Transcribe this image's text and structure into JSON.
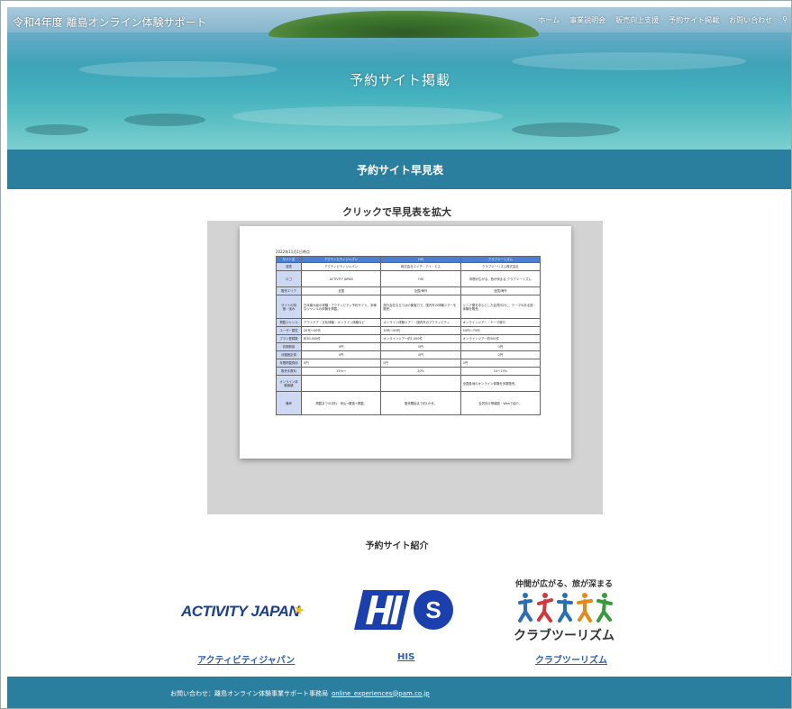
{
  "header": {
    "site_title": "令和4年度 離島オンライン体験サポート",
    "nav": [
      "ホーム",
      "事業説明会",
      "販売向上支援",
      "予約サイト掲載",
      "お問い合わせ"
    ],
    "hero_title": "予約サイト掲載"
  },
  "section_bar": {
    "title": "予約サイト早見表"
  },
  "preview": {
    "caption": "クリックで早見表を拡大",
    "doc_date": "2022年11月1日時点",
    "columns": [
      "サイト名",
      "アクティビティジャパン",
      "HIS",
      "クラブツーリズム"
    ],
    "rows": [
      {
        "head": "運営",
        "cells": [
          "アクティビティジャパン",
          "株式会社エイチ・アイ・エス",
          "クラブツーリズム株式会社"
        ]
      },
      {
        "head": "ロゴ",
        "cells": [
          "ACTIVITY JAPAN",
          "HIS",
          "仲間が広がる、旅が深まる クラブツーリズム"
        ]
      },
      {
        "head": "販売エリア",
        "cells": [
          "全国",
          "全国/海外",
          "全国/海外"
        ]
      },
      {
        "head": "サイトの特徴・強み",
        "cells": [
          "日本最大級の体験・アクティビティ予約サイト。多様なジャンルの体験を掲載。",
          "旅行会社ならではの集客力で、国内外の体験ツアーを販売。",
          "シニア層を中心とした会員向けに、テーマのある旅・体験を販売。"
        ]
      },
      {
        "head": "掲載ジャンル",
        "cells": [
          "アウトドア・文化体験・オンライン体験など",
          "オンライン体験ツアー・国内外のアクティビティ",
          "オンラインツアー・テーマ旅行"
        ]
      },
      {
        "head": "ユーザー属性",
        "cells": [
          "20代〜40代",
          "30代〜60代",
          "50代〜70代"
        ]
      },
      {
        "head": "プラン登録数",
        "cells": [
          "約30,000件",
          "オンラインツアー約1,000件",
          "オンラインツアー約500件"
        ]
      },
      {
        "head": "初期費用",
        "cells": [
          "0円",
          "0円",
          "0円"
        ]
      },
      {
        "head": "月額固定費",
        "cells": [
          "0円",
          "0円",
          "0円"
        ]
      },
      {
        "head": "年間掲載費用",
        "cells": [
          "0円",
          "0円",
          "0円"
        ]
      },
      {
        "head": "販売手数料",
        "cells": [
          "15%〜",
          "20%",
          "10〜15%"
        ]
      },
      {
        "head": "オンライン体験実績",
        "cells": [
          "",
          "",
          "全国各地のオンライン体験を多数販売。"
        ]
      },
      {
        "head": "備考",
        "cells": [
          "掲載までの流れ：申込→審査→掲載。",
          "販売開始まで約1か月。",
          "会員向け情報誌・Webで紹介。"
        ]
      }
    ]
  },
  "intro": {
    "title": "予約サイト紹介"
  },
  "sites": [
    {
      "name": "アクティビティジャパン",
      "logo_text": "ACTIVITY JAPAN"
    },
    {
      "name": "HIS",
      "logo_text": "HIS"
    },
    {
      "name": "クラブツーリズム",
      "logo_tagline": "仲間が広がる、旅が深まる",
      "logo_text": "クラブツーリズム"
    }
  ],
  "footer": {
    "label": "お問い合わせ：離島オンライン体験事業サポート事務局",
    "email": "online_experiences@pam.co.jp"
  }
}
